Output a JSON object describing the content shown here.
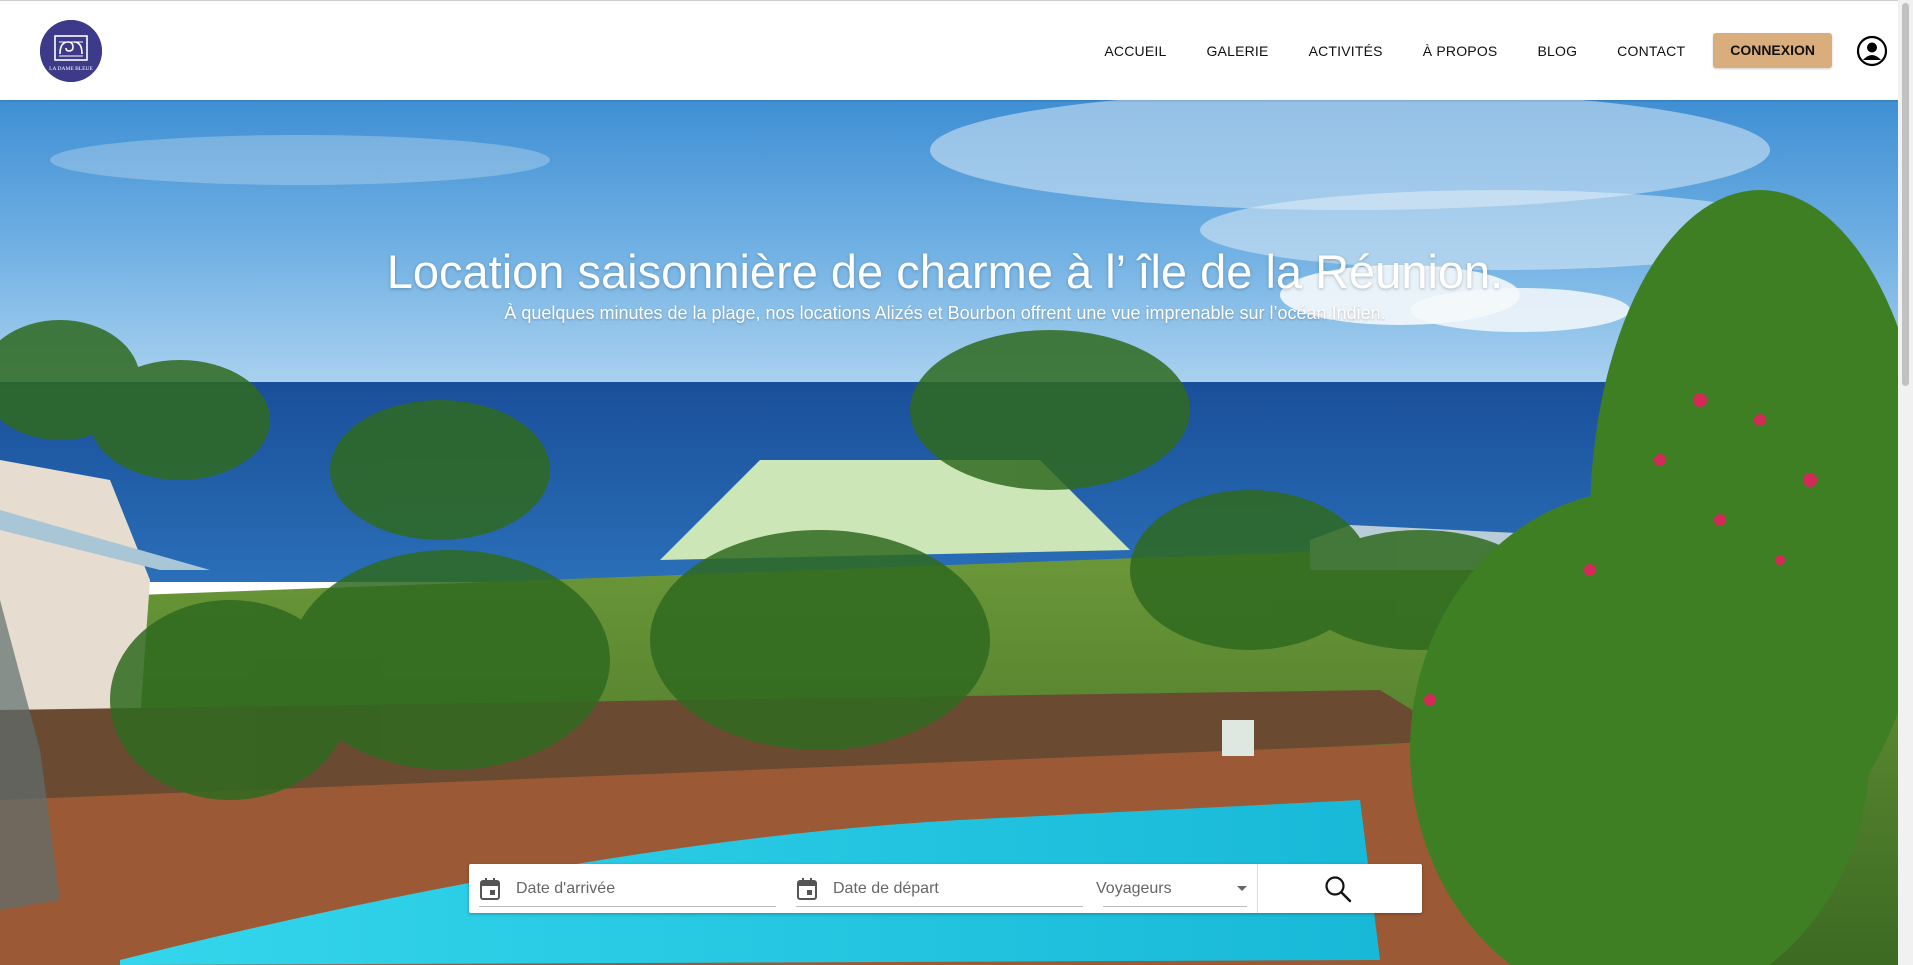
{
  "header": {
    "logo_icon": "la-dame-blue-logo",
    "logo_text": "LA DAME BLEUE",
    "nav": [
      {
        "label": "ACCUEIL"
      },
      {
        "label": "GALERIE"
      },
      {
        "label": "ACTIVITÉS"
      },
      {
        "label": "À PROPOS"
      },
      {
        "label": "BLOG"
      },
      {
        "label": "CONTACT"
      }
    ],
    "login_label": "CONNEXION",
    "account_icon": "account-circle-icon"
  },
  "hero": {
    "title": "Location saisonnière de charme à l’ île de la Réunion.",
    "subtitle": "À quelques minutes de la plage, nos locations Alizés et Bourbon offrent une vue imprenable sur l’océan Indien."
  },
  "search": {
    "arrival_placeholder": "Date d'arrivée",
    "departure_placeholder": "Date de départ",
    "guests_placeholder": "Voyageurs",
    "calendar_icon": "calendar-icon",
    "search_icon": "search-icon"
  },
  "colors": {
    "accent": "#d9ad7c",
    "logo": "#3d3a8a"
  }
}
